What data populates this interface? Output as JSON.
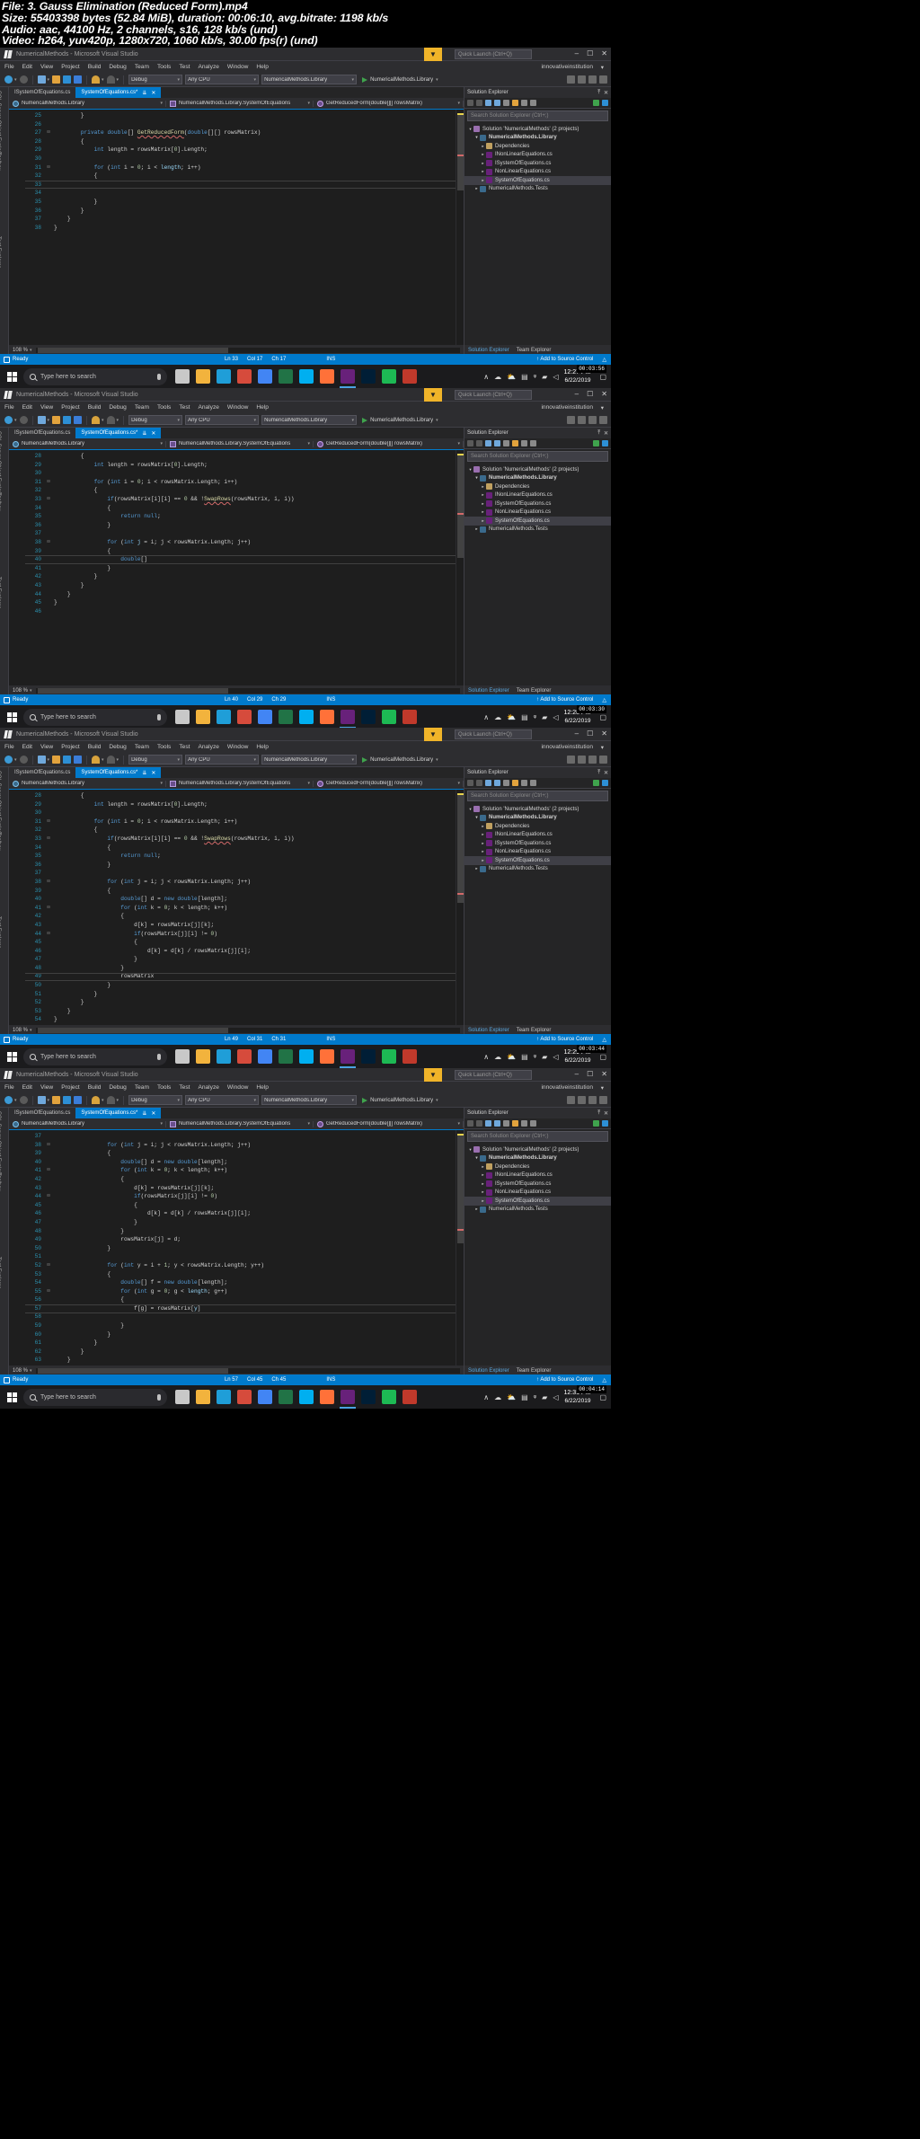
{
  "fileinfo": {
    "line1": "File: 3. Gauss Elimination (Reduced Form).mp4",
    "line2": "Size: 55403398 bytes (52.84 MiB), duration: 00:06:10, avg.bitrate: 1198 kb/s",
    "line3": "Audio: aac, 44100 Hz, 2 channels, s16, 128 kb/s (und)",
    "line4": "Video: h264, yuv420p, 1280x720, 1060 kb/s, 30.00 fps(r) (und)"
  },
  "vs": {
    "title": "NumericalMethods - Microsoft Visual Studio",
    "quick_launch_placeholder": "Quick Launch (Ctrl+Q)",
    "account": "innovativeinstitution",
    "account_caret": "▾",
    "win_min": "–",
    "win_max": "☐",
    "win_close": "✕",
    "menu": [
      "File",
      "Edit",
      "View",
      "Project",
      "Build",
      "Debug",
      "Team",
      "Tools",
      "Test",
      "Analyze",
      "Window",
      "Help"
    ],
    "toolbar": {
      "config": "Debug",
      "platform": "Any CPU",
      "startup_project": "NumericalMethods.Library",
      "run_target": "NumericalMethods.Library",
      "caret": "▾"
    },
    "tabs": [
      {
        "label": "ISystemOfEquations.cs",
        "active": false
      },
      {
        "label": "SystemOfEquations.cs*",
        "active": true,
        "pin": "⇊",
        "close": "✕"
      }
    ],
    "nav": {
      "project": "NumericalMethods.Library",
      "type": "NumericalMethods.Library.SystemOfEquations",
      "member": "GetReducedForm(double[][] rowsMatrix)"
    },
    "zoom_level": "108 %",
    "solution_explorer": {
      "title": "Solution Explorer",
      "pin": "⤒",
      "close": "✕",
      "search_placeholder": "Search Solution Explorer (Ctrl+;)",
      "tree": [
        {
          "label": "Solution 'NumericalMethods' (2 projects)",
          "depth": 0,
          "arrow": "▾",
          "icon": "solution-icon",
          "bold": false,
          "selected": false
        },
        {
          "label": "NumericalMethods.Library",
          "depth": 1,
          "arrow": "▾",
          "icon": "project-icon",
          "bold": true,
          "selected": false
        },
        {
          "label": "Dependencies",
          "depth": 2,
          "arrow": "▸",
          "icon": "dependencies-icon",
          "bold": false,
          "selected": false
        },
        {
          "label": "INonLinearEquations.cs",
          "depth": 2,
          "arrow": "▸",
          "icon": "csharp-icon",
          "bold": false,
          "selected": false
        },
        {
          "label": "ISystemOfEquations.cs",
          "depth": 2,
          "arrow": "▸",
          "icon": "csharp-icon",
          "bold": false,
          "selected": false
        },
        {
          "label": "NonLinearEquations.cs",
          "depth": 2,
          "arrow": "▸",
          "icon": "csharp-icon",
          "bold": false,
          "selected": false
        },
        {
          "label": "SystemOfEquations.cs",
          "depth": 2,
          "arrow": "▸",
          "icon": "csharp-icon",
          "bold": false,
          "selected": true
        },
        {
          "label": "NumericalMethods.Tests",
          "depth": 1,
          "arrow": "▸",
          "icon": "project-icon",
          "bold": false,
          "selected": false
        }
      ],
      "bottom_tabs": [
        {
          "label": "Solution Explorer",
          "active": true
        },
        {
          "label": "Team Explorer",
          "active": false
        }
      ]
    },
    "left_strip": [
      "SQL Server Object Explorer",
      "Toolbox",
      "Test Explorer"
    ],
    "status": {
      "ready": "Ready",
      "source_control": "Add to Source Control",
      "ins": "INS"
    }
  },
  "frames": [
    {
      "id": "frame-1",
      "caret": {
        "ln": "Ln 33",
        "col": "Col 17",
        "ch": "Ch 17"
      },
      "clock": {
        "time": "12:27 PM",
        "date": "6/22/2019"
      },
      "timecode": "00:03:56",
      "code": [
        {
          "n": "25",
          "fold": "",
          "chg": "y",
          "html": "        }"
        },
        {
          "n": "26",
          "fold": "",
          "chg": "y",
          "html": ""
        },
        {
          "n": "27",
          "fold": "⊟",
          "chg": "y",
          "html": "        <span class=\"k\">private</span> <span class=\"k\">double</span>[] <span class=\"m sq\">GetReducedForm</span>(<span class=\"k\">double</span>[][] rowsMatrix)"
        },
        {
          "n": "28",
          "fold": "",
          "chg": "y",
          "html": "        {"
        },
        {
          "n": "29",
          "fold": "",
          "chg": "y",
          "html": "            <span class=\"k\">int</span> length = rowsMatrix[<span class=\"n\">0</span>].Length;"
        },
        {
          "n": "30",
          "fold": "",
          "chg": "y",
          "html": ""
        },
        {
          "n": "31",
          "fold": "⊟",
          "chg": "y",
          "html": "            <span class=\"k\">for</span> (<span class=\"k\">int</span> i = <span class=\"n\">0</span>; i &lt; <span class=\"p\">length</span>; i++)"
        },
        {
          "n": "32",
          "fold": "",
          "chg": "y",
          "html": "            {"
        },
        {
          "n": "33",
          "fold": "",
          "chg": "y",
          "html": "",
          "caret": true
        },
        {
          "n": "34",
          "fold": "",
          "chg": "y",
          "html": ""
        },
        {
          "n": "35",
          "fold": "",
          "chg": "y",
          "html": "            }"
        },
        {
          "n": "36",
          "fold": "",
          "chg": "y",
          "html": "        }"
        },
        {
          "n": "37",
          "fold": "",
          "chg": "g",
          "html": "    }"
        },
        {
          "n": "38",
          "fold": "",
          "chg": "",
          "html": "}"
        }
      ]
    },
    {
      "id": "frame-2",
      "caret": {
        "ln": "Ln 40",
        "col": "Col 29",
        "ch": "Ch 29"
      },
      "clock": {
        "time": "12:28 PM",
        "date": "6/22/2019"
      },
      "timecode": "00:03:30",
      "code": [
        {
          "n": "28",
          "fold": "",
          "chg": "y",
          "html": "        {"
        },
        {
          "n": "29",
          "fold": "",
          "chg": "y",
          "html": "            <span class=\"k\">int</span> length = rowsMatrix[<span class=\"n\">0</span>].Length;"
        },
        {
          "n": "30",
          "fold": "",
          "chg": "y",
          "html": ""
        },
        {
          "n": "31",
          "fold": "⊟",
          "chg": "y",
          "html": "            <span class=\"k\">for</span> (<span class=\"k\">int</span> i = <span class=\"n\">0</span>; i &lt; rowsMatrix.Length; i++)"
        },
        {
          "n": "32",
          "fold": "",
          "chg": "y",
          "html": "            {"
        },
        {
          "n": "33",
          "fold": "⊟",
          "chg": "y",
          "html": "                <span class=\"k\">if</span>(rowsMatrix[i][i] == <span class=\"n\">0</span> &amp;&amp; !<span class=\"m sq\">SwapRows</span>(rowsMatrix, i, i))"
        },
        {
          "n": "34",
          "fold": "",
          "chg": "y",
          "html": "                {"
        },
        {
          "n": "35",
          "fold": "",
          "chg": "y",
          "html": "                    <span class=\"k\">return</span> <span class=\"k\">null</span>;"
        },
        {
          "n": "36",
          "fold": "",
          "chg": "y",
          "html": "                }"
        },
        {
          "n": "37",
          "fold": "",
          "chg": "y",
          "html": ""
        },
        {
          "n": "38",
          "fold": "⊟",
          "chg": "y",
          "html": "                <span class=\"k\">for</span> (<span class=\"k\">int</span> <span class=\"p\">j</span> = i; j &lt; rowsMatrix.Length; j++)"
        },
        {
          "n": "39",
          "fold": "",
          "chg": "y",
          "html": "                {"
        },
        {
          "n": "40",
          "fold": "",
          "chg": "y",
          "html": "                    <span class=\"k\">double</span>[]",
          "caret": true
        },
        {
          "n": "41",
          "fold": "",
          "chg": "y",
          "html": "                }"
        },
        {
          "n": "42",
          "fold": "",
          "chg": "y",
          "html": "            }"
        },
        {
          "n": "43",
          "fold": "",
          "chg": "y",
          "html": "        }"
        },
        {
          "n": "44",
          "fold": "",
          "chg": "y",
          "html": "    }"
        },
        {
          "n": "45",
          "fold": "",
          "chg": "g",
          "html": "}"
        },
        {
          "n": "46",
          "fold": "",
          "chg": "",
          "html": ""
        }
      ]
    },
    {
      "id": "frame-3",
      "caret": {
        "ln": "Ln 49",
        "col": "Col 31",
        "ch": "Ch 31"
      },
      "clock": {
        "time": "12:29 PM",
        "date": "6/22/2019"
      },
      "timecode": "00:03:44",
      "code": [
        {
          "n": "28",
          "fold": "",
          "chg": "y",
          "html": "        {"
        },
        {
          "n": "29",
          "fold": "",
          "chg": "y",
          "html": "            <span class=\"k\">int</span> length = rowsMatrix[<span class=\"n\">0</span>].Length;"
        },
        {
          "n": "30",
          "fold": "",
          "chg": "y",
          "html": ""
        },
        {
          "n": "31",
          "fold": "⊟",
          "chg": "y",
          "html": "            <span class=\"k\">for</span> (<span class=\"k\">int</span> i = <span class=\"n\">0</span>; i &lt; rowsMatrix.Length; i++)"
        },
        {
          "n": "32",
          "fold": "",
          "chg": "y",
          "html": "            {"
        },
        {
          "n": "33",
          "fold": "⊟",
          "chg": "y",
          "html": "                <span class=\"k\">if</span>(rowsMatrix[i][i] == <span class=\"n\">0</span> &amp;&amp; !<span class=\"m sq\">SwapRows</span>(rowsMatrix, i, i))"
        },
        {
          "n": "34",
          "fold": "",
          "chg": "y",
          "html": "                {"
        },
        {
          "n": "35",
          "fold": "",
          "chg": "y",
          "html": "                    <span class=\"k\">return</span> <span class=\"k\">null</span>;"
        },
        {
          "n": "36",
          "fold": "",
          "chg": "y",
          "html": "                }"
        },
        {
          "n": "37",
          "fold": "",
          "chg": "y",
          "html": ""
        },
        {
          "n": "38",
          "fold": "⊟",
          "chg": "y",
          "html": "                <span class=\"k\">for</span> (<span class=\"k\">int</span> j = i; j &lt; rowsMatrix.Length; j++)"
        },
        {
          "n": "39",
          "fold": "",
          "chg": "y",
          "html": "                {"
        },
        {
          "n": "40",
          "fold": "",
          "chg": "y",
          "html": "                    <span class=\"k\">double</span>[] d = <span class=\"k\">new</span> <span class=\"k\">double</span>[length];"
        },
        {
          "n": "41",
          "fold": "⊟",
          "chg": "y",
          "html": "                    <span class=\"k\">for</span> (<span class=\"k\">int</span> k = <span class=\"n\">0</span>; k &lt; length; k++)"
        },
        {
          "n": "42",
          "fold": "",
          "chg": "y",
          "html": "                    {"
        },
        {
          "n": "43",
          "fold": "",
          "chg": "y",
          "html": "                        d[k] = rowsMatrix[j][k];"
        },
        {
          "n": "44",
          "fold": "⊟",
          "chg": "y",
          "html": "                        <span class=\"k\">if</span>(rowsMatrix[j][i] != <span class=\"n\">0</span>)"
        },
        {
          "n": "45",
          "fold": "",
          "chg": "y",
          "html": "                        {"
        },
        {
          "n": "46",
          "fold": "",
          "chg": "y",
          "html": "                            d[k] = d[k] / rowsMatrix[j][i];"
        },
        {
          "n": "47",
          "fold": "",
          "chg": "y",
          "html": "                        }"
        },
        {
          "n": "48",
          "fold": "",
          "chg": "y",
          "html": "                    }"
        },
        {
          "n": "49",
          "fold": "",
          "chg": "y",
          "html": "                    rowsMatrix",
          "caret": true
        },
        {
          "n": "50",
          "fold": "",
          "chg": "y",
          "html": "                }"
        },
        {
          "n": "51",
          "fold": "",
          "chg": "y",
          "html": "            }"
        },
        {
          "n": "52",
          "fold": "",
          "chg": "y",
          "html": "        }"
        },
        {
          "n": "53",
          "fold": "",
          "chg": "y",
          "html": "    }"
        },
        {
          "n": "54",
          "fold": "",
          "chg": "g",
          "html": "}"
        }
      ]
    },
    {
      "id": "frame-4",
      "caret": {
        "ln": "Ln 57",
        "col": "Col 45",
        "ch": "Ch 45"
      },
      "clock": {
        "time": "12:31 PM",
        "date": "6/22/2019"
      },
      "timecode": "00:04:14",
      "code": [
        {
          "n": "37",
          "fold": "",
          "chg": "y",
          "html": ""
        },
        {
          "n": "38",
          "fold": "⊟",
          "chg": "y",
          "html": "                <span class=\"k\">for</span> (<span class=\"k\">int</span> j = i; j &lt; rowsMatrix.Length; j++)"
        },
        {
          "n": "39",
          "fold": "",
          "chg": "y",
          "html": "                {"
        },
        {
          "n": "40",
          "fold": "",
          "chg": "y",
          "html": "                    <span class=\"k\">double</span>[] d = <span class=\"k\">new</span> <span class=\"k\">double</span>[length];"
        },
        {
          "n": "41",
          "fold": "⊟",
          "chg": "y",
          "html": "                    <span class=\"k\">for</span> (<span class=\"k\">int</span> k = <span class=\"n\">0</span>; k &lt; length; k++)"
        },
        {
          "n": "42",
          "fold": "",
          "chg": "y",
          "html": "                    {"
        },
        {
          "n": "43",
          "fold": "",
          "chg": "y",
          "html": "                        d[k] = rowsMatrix[j][k];"
        },
        {
          "n": "44",
          "fold": "⊟",
          "chg": "y",
          "html": "                        <span class=\"k\">if</span>(rowsMatrix[j][i] != <span class=\"n\">0</span>)"
        },
        {
          "n": "45",
          "fold": "",
          "chg": "y",
          "html": "                        {"
        },
        {
          "n": "46",
          "fold": "",
          "chg": "y",
          "html": "                            d[k] = d[k] / rowsMatrix[j][i];"
        },
        {
          "n": "47",
          "fold": "",
          "chg": "y",
          "html": "                        }"
        },
        {
          "n": "48",
          "fold": "",
          "chg": "y",
          "html": "                    }"
        },
        {
          "n": "49",
          "fold": "",
          "chg": "y",
          "html": "                    rowsMatrix[j] = d;"
        },
        {
          "n": "50",
          "fold": "",
          "chg": "y",
          "html": "                }"
        },
        {
          "n": "51",
          "fold": "",
          "chg": "y",
          "html": ""
        },
        {
          "n": "52",
          "fold": "⊟",
          "chg": "y",
          "html": "                <span class=\"k\">for</span> (<span class=\"k\">int</span> y = i + <span class=\"n\">1</span>; y &lt; rowsMatrix.Length; y++)"
        },
        {
          "n": "53",
          "fold": "",
          "chg": "y",
          "html": "                {"
        },
        {
          "n": "54",
          "fold": "",
          "chg": "y",
          "html": "                    <span class=\"k\">double</span>[] f = <span class=\"k\">new</span> <span class=\"k\">double</span>[length];"
        },
        {
          "n": "55",
          "fold": "⊟",
          "chg": "y",
          "html": "                    <span class=\"k\">for</span> (<span class=\"k\">int</span> g = <span class=\"n\">0</span>; g &lt; <span class=\"p\">length</span>; g++)"
        },
        {
          "n": "56",
          "fold": "",
          "chg": "y",
          "html": "                    {"
        },
        {
          "n": "57",
          "fold": "",
          "chg": "y",
          "html": "                        f[g] = rowsMatrix[<span class=\"p\">y</span>]",
          "caret": true
        },
        {
          "n": "58",
          "fold": "",
          "chg": "y",
          "html": ""
        },
        {
          "n": "59",
          "fold": "",
          "chg": "y",
          "html": "                    }"
        },
        {
          "n": "60",
          "fold": "",
          "chg": "y",
          "html": "                }"
        },
        {
          "n": "61",
          "fold": "",
          "chg": "y",
          "html": "            }"
        },
        {
          "n": "62",
          "fold": "",
          "chg": "y",
          "html": "        }"
        },
        {
          "n": "63",
          "fold": "",
          "chg": "y",
          "html": "    }"
        },
        {
          "n": "64",
          "fold": "",
          "chg": "g",
          "html": "}"
        }
      ]
    }
  ],
  "taskbar": {
    "search_placeholder": "Type here to search",
    "icons": [
      {
        "name": "task-view-icon",
        "color": "#c8c8c8"
      },
      {
        "name": "file-explorer-icon",
        "color": "#f2b33d"
      },
      {
        "name": "store-icon",
        "color": "#1f9ed8"
      },
      {
        "name": "mail-icon",
        "color": "#d64b3c"
      },
      {
        "name": "chrome-icon",
        "color": "#4285f4"
      },
      {
        "name": "excel-icon",
        "color": "#217346"
      },
      {
        "name": "skype-icon",
        "color": "#00aff0"
      },
      {
        "name": "firefox-icon",
        "color": "#ff7139"
      },
      {
        "name": "visual-studio-icon",
        "color": "#68217a"
      },
      {
        "name": "photoshop-icon",
        "color": "#001e36"
      },
      {
        "name": "spotify-icon",
        "color": "#1db954"
      },
      {
        "name": "recorder-icon",
        "color": "#c0392b"
      }
    ],
    "tray": [
      "∧",
      "☁",
      "⛅",
      "▤",
      "ᵠ"
    ],
    "network": "▰",
    "volume": "◁",
    "notif": "▢"
  },
  "colors": {
    "accent": "#007acc",
    "vs_chrome": "#2d2d30",
    "editor_bg": "#1e1e1e",
    "keyword": "#569cd6",
    "type": "#4ec9b0",
    "method": "#dcdcaa",
    "number": "#b5cea8",
    "linenum": "#2b91af",
    "taskbar": "#1b1b1d",
    "highlight": "#f0b429"
  }
}
